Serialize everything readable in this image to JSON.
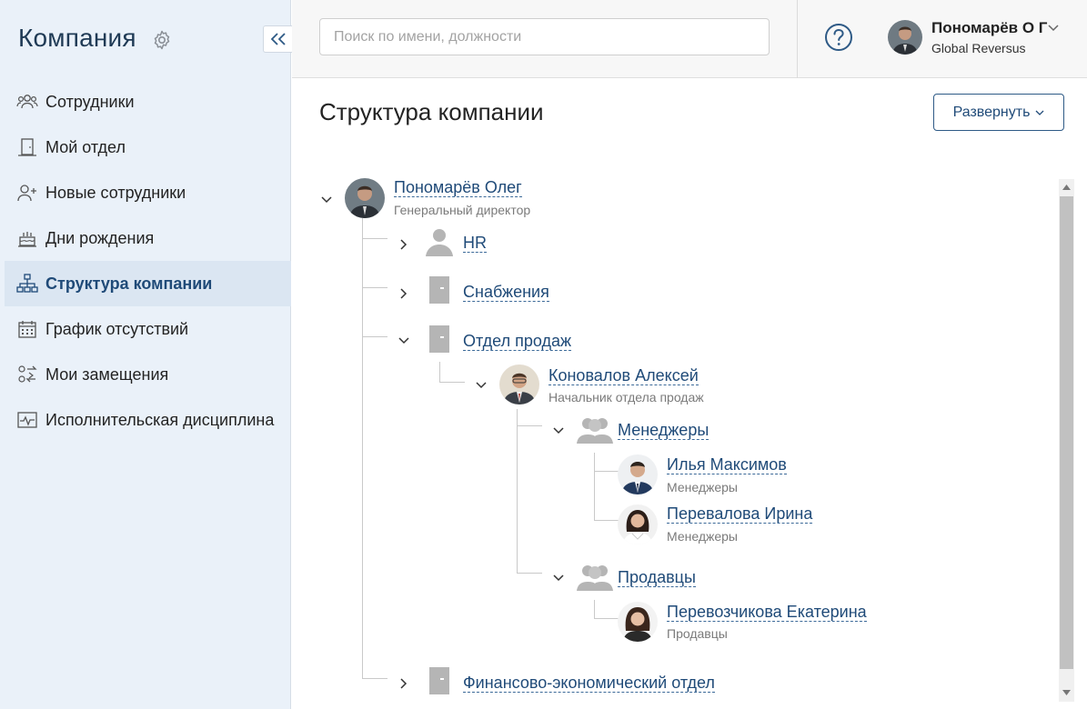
{
  "sidebar": {
    "title": "Компания",
    "items": [
      {
        "label": "Сотрудники",
        "icon": "people-icon"
      },
      {
        "label": "Мой отдел",
        "icon": "door-icon"
      },
      {
        "label": "Новые сотрудники",
        "icon": "add-user-icon"
      },
      {
        "label": "Дни рождения",
        "icon": "cake-icon"
      },
      {
        "label": "Структура компании",
        "icon": "org-structure-icon",
        "active": true
      },
      {
        "label": "График отсутствий",
        "icon": "calendar-icon"
      },
      {
        "label": "Мои замещения",
        "icon": "substitution-icon"
      },
      {
        "label": "Исполнительская дисциплина",
        "icon": "pulse-chart-icon"
      }
    ]
  },
  "header": {
    "search_placeholder": "Поиск по имени, должности",
    "user_name": "Пономарёв О Г",
    "user_company": "Global Reversus"
  },
  "main": {
    "title": "Структура компании",
    "expand_label": "Развернуть"
  },
  "tree": {
    "root": {
      "name": "Пономарёв Олег",
      "position": "Генеральный директор"
    },
    "hr": {
      "name": "HR"
    },
    "supply": {
      "name": "Снабжения"
    },
    "sales_dept": {
      "name": "Отдел продаж"
    },
    "sales_head": {
      "name": "Коновалов Алексей",
      "position": "Начальник отдела продаж"
    },
    "managers": {
      "name": "Менеджеры"
    },
    "manager1": {
      "name": "Илья Максимов",
      "position": "Менеджеры"
    },
    "manager2": {
      "name": "Перевалова Ирина",
      "position": "Менеджеры"
    },
    "sellers": {
      "name": "Продавцы"
    },
    "seller1": {
      "name": "Перевозчикова Екатерина",
      "position": "Продавцы"
    },
    "finance": {
      "name": "Финансово-экономический отдел"
    }
  },
  "colors": {
    "accent": "#1f4a78",
    "sidebar_bg": "#eaf1f9",
    "active_item_bg": "#dbe6f2"
  }
}
